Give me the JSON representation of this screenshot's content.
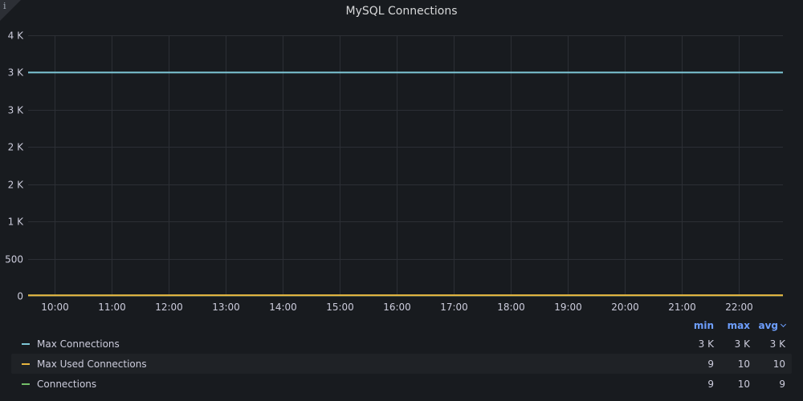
{
  "panel": {
    "title": "MySQL Connections",
    "info_icon": "info-icon"
  },
  "colors": {
    "background": "#181b1f",
    "grid": "#2c2f35",
    "max_connections": "#7ec8d8",
    "max_used_connections": "#e8b53f",
    "connections": "#73bf69",
    "legend_header": "#6e9fff"
  },
  "chart_data": {
    "type": "line",
    "title": "MySQL Connections",
    "xlabel": "",
    "ylabel": "",
    "ylim": [
      0,
      3500
    ],
    "y_tick_values": [
      0,
      500,
      1000,
      1500,
      2000,
      2500,
      3000,
      3500
    ],
    "y_tick_labels": [
      "0",
      "500",
      "1 K",
      "2 K",
      "2 K",
      "3 K",
      "3 K",
      "4 K"
    ],
    "x_tick_labels": [
      "10:00",
      "11:00",
      "12:00",
      "13:00",
      "14:00",
      "15:00",
      "16:00",
      "17:00",
      "18:00",
      "19:00",
      "20:00",
      "21:00",
      "22:00"
    ],
    "x_range_hours": [
      9.53,
      22.78
    ],
    "x_tick_hours": [
      10,
      11,
      12,
      13,
      14,
      15,
      16,
      17,
      18,
      19,
      20,
      21,
      22
    ],
    "grid": true,
    "legend_placement": "bottom",
    "series": [
      {
        "name": "Max Connections",
        "x": [
          9.53,
          22.78
        ],
        "values": [
          3000,
          3000
        ]
      },
      {
        "name": "Max Used Connections",
        "x": [
          9.53,
          22.78
        ],
        "values": [
          9,
          10
        ]
      },
      {
        "name": "Connections",
        "x": [
          9.53,
          22.78
        ],
        "values": [
          9,
          9
        ]
      }
    ]
  },
  "legend": {
    "headers": {
      "min": "min",
      "max": "max",
      "avg": "avg"
    },
    "rows": [
      {
        "name": "Max Connections",
        "min": "3 K",
        "max": "3 K",
        "avg": "3 K"
      },
      {
        "name": "Max Used Connections",
        "min": "9",
        "max": "10",
        "avg": "10"
      },
      {
        "name": "Connections",
        "min": "9",
        "max": "10",
        "avg": "9"
      }
    ]
  }
}
